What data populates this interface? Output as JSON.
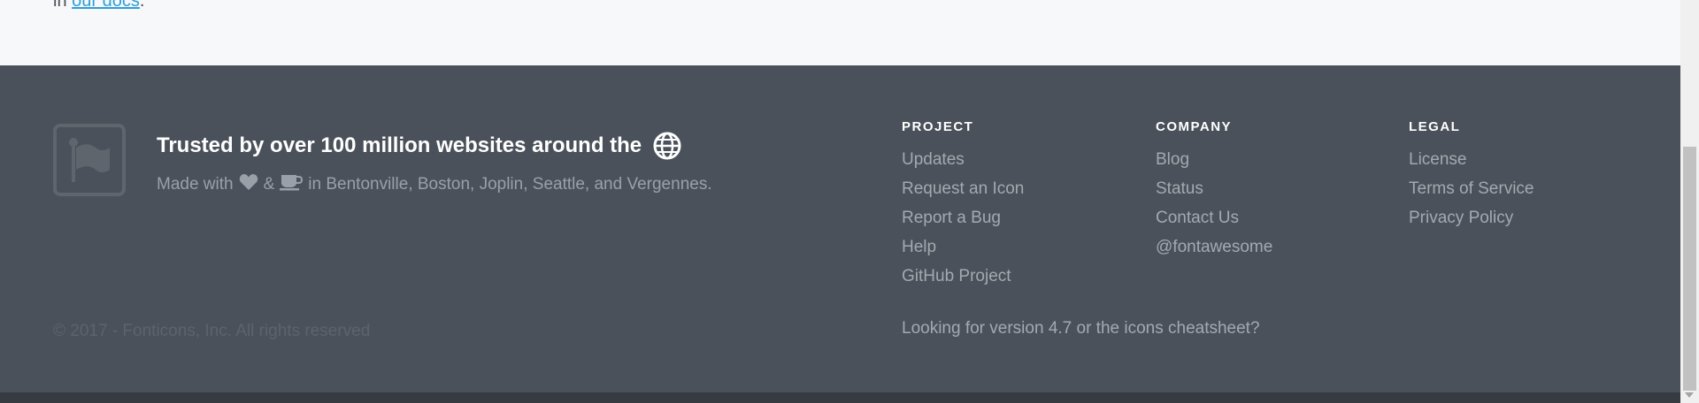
{
  "top": {
    "prefix": "in",
    "docs_link": "our docs",
    "suffix": "."
  },
  "footer": {
    "tagline": "Trusted by over 100 million websites around the",
    "made_with": {
      "prefix": "Made with",
      "ampersand": "&",
      "suffix": "in Bentonville, Boston, Joplin, Seattle, and Vergennes."
    },
    "copyright": "© 2017 - Fonticons, Inc. All rights reserved",
    "columns": {
      "project": {
        "heading": "PROJECT",
        "links": [
          "Updates",
          "Request an Icon",
          "Report a Bug",
          "Help",
          "GitHub Project"
        ]
      },
      "company": {
        "heading": "COMPANY",
        "links": [
          "Blog",
          "Status",
          "Contact Us",
          "@fontawesome"
        ]
      },
      "legal": {
        "heading": "LEGAL",
        "links": [
          "License",
          "Terms of Service",
          "Privacy Policy"
        ]
      }
    },
    "looking_for": "Looking for version 4.7 or the icons cheatsheet?",
    "icons": {
      "brand": "flag-icon",
      "globe": "globe-icon",
      "heart": "heart-icon",
      "coffee": "coffee-icon"
    }
  },
  "colors": {
    "footer_bg": "#4b515a",
    "link": "#2f9fd8",
    "heading": "#ffffff",
    "link_text": "#a4a9b0"
  }
}
